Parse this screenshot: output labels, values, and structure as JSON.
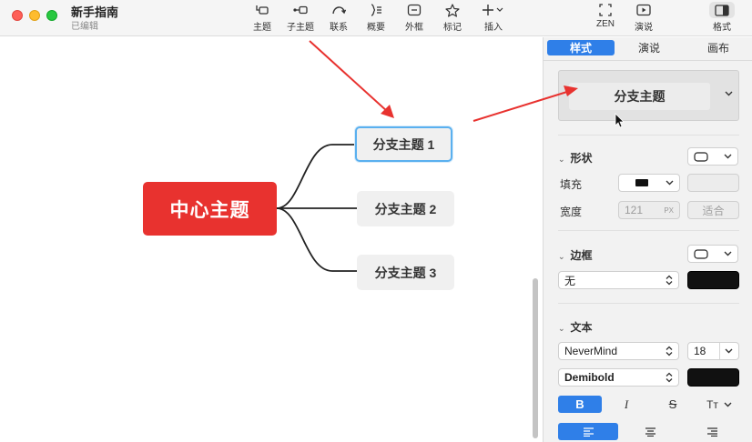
{
  "window": {
    "title": "新手指南",
    "subtitle": "已编辑"
  },
  "toolbar": {
    "items": [
      {
        "label": "主题",
        "icon": "topic-icon"
      },
      {
        "label": "子主题",
        "icon": "subtopic-icon"
      },
      {
        "label": "联系",
        "icon": "relationship-icon"
      },
      {
        "label": "概要",
        "icon": "summary-icon"
      },
      {
        "label": "外框",
        "icon": "boundary-icon"
      },
      {
        "label": "标记",
        "icon": "star-icon"
      },
      {
        "label": "插入",
        "icon": "plus-icon"
      },
      {
        "label": "ZEN",
        "icon": "zen-icon"
      },
      {
        "label": "演说",
        "icon": "pitch-icon"
      },
      {
        "label": "格式",
        "icon": "format-panel-icon"
      }
    ]
  },
  "canvas": {
    "central_topic": "中心主题",
    "branches": [
      "分支主题 1",
      "分支主题 2",
      "分支主题 3"
    ],
    "selected_branch": 0,
    "colors": {
      "central": "#e8322f",
      "branch": "#f0f0f0",
      "selection": "#5ab0ef",
      "arrow": "#e8322f"
    }
  },
  "sidebar": {
    "tabs": [
      "样式",
      "演说",
      "画布"
    ],
    "active_tab": 0,
    "preview_label": "分支主题",
    "shape": {
      "title": "形状",
      "fill_label": "填充",
      "width_label": "宽度",
      "width_value": "121",
      "width_unit": "PX",
      "fit_label": "适合"
    },
    "border": {
      "title": "边框",
      "style_value": "无"
    },
    "text": {
      "title": "文本",
      "font_family": "NeverMind",
      "font_size": "18",
      "font_weight": "Demibold",
      "bold": "B",
      "italic": "I",
      "strike": "S",
      "case": "Tт"
    }
  }
}
